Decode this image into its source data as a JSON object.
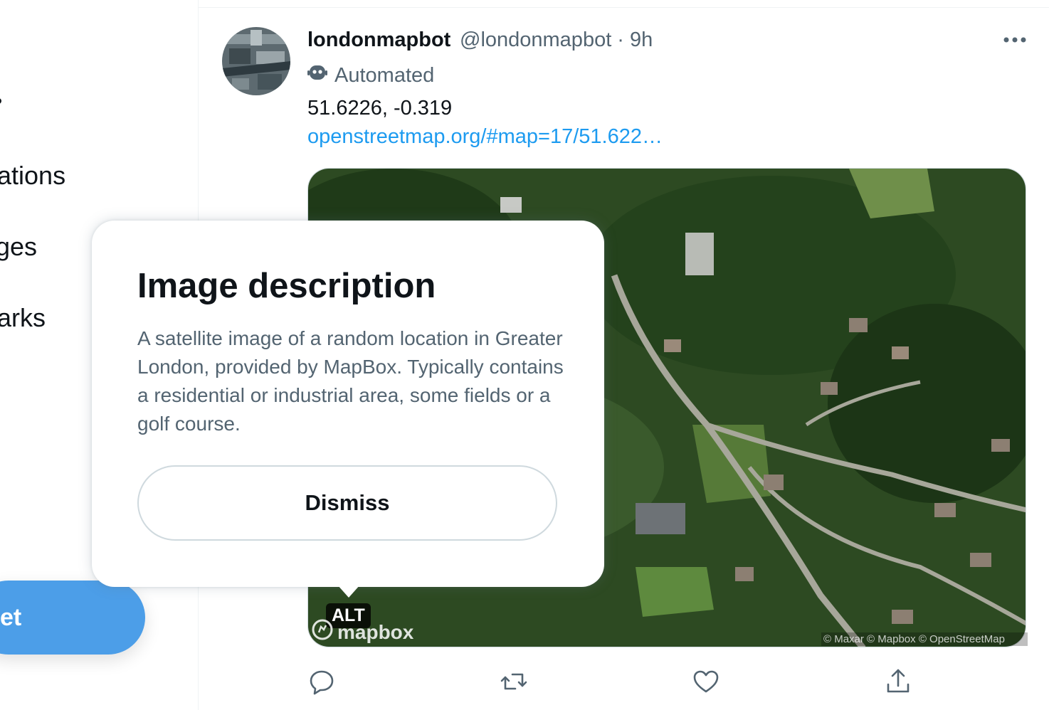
{
  "nav": {
    "items": [
      {
        "label": "ations"
      },
      {
        "label": "ges"
      },
      {
        "label": "arks"
      }
    ],
    "tweet_button_label": "et"
  },
  "tweet": {
    "display_name": "londonmapbot",
    "handle_time": "@londonmapbot · 9h",
    "automated_label": "Automated",
    "text": "51.6226, -0.319",
    "link_text": "openstreetmap.org/#map=17/51.622…",
    "media": {
      "alt_badge": "ALT",
      "logo_text": "mapbox",
      "attribution": "© Maxar © Mapbox © OpenStreetMap"
    },
    "actions": [
      "reply-icon",
      "retweet-icon",
      "like-icon",
      "share-icon"
    ]
  },
  "popover": {
    "title": "Image description",
    "body": "A satellite image of a random location in Greater London, provided by MapBox. Typically contains a residential or industrial area, some fields or a golf course.",
    "dismiss_label": "Dismiss"
  },
  "colors": {
    "accent": "#1d9bf0",
    "tweet_button": "#4c9ee8",
    "secondary_text": "#536471",
    "border": "#cfd9de"
  }
}
